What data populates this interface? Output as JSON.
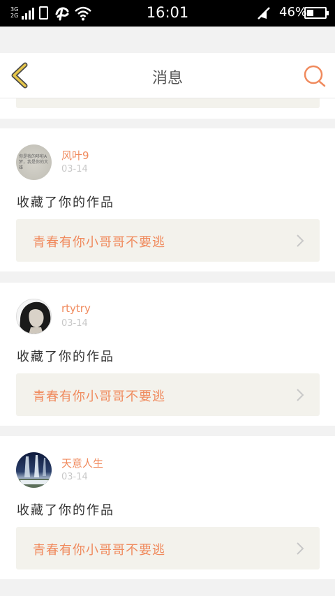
{
  "status_bar": {
    "network_top": "3G",
    "network_bottom": "2G",
    "time": "16:01",
    "battery_percent": "46%",
    "battery_level": 0.46
  },
  "header": {
    "title": "消息"
  },
  "messages": [
    {
      "name": "风叶9",
      "date": "03-14",
      "action": "收藏了你的作品",
      "work_title": "青春有你小哥哥不要逃",
      "avatar_text": "你是我的哆啦A梦，我是你的大雄"
    },
    {
      "name": "rtytry",
      "date": "03-14",
      "action": "收藏了你的作品",
      "work_title": "青春有你小哥哥不要逃"
    },
    {
      "name": "天意人生",
      "date": "03-14",
      "action": "收藏了你的作品",
      "work_title": "青春有你小哥哥不要逃"
    }
  ],
  "colors": {
    "accent": "#f08a5d",
    "back_arrow": "#e6c64a",
    "card_bubble": "#f3f2ec"
  }
}
